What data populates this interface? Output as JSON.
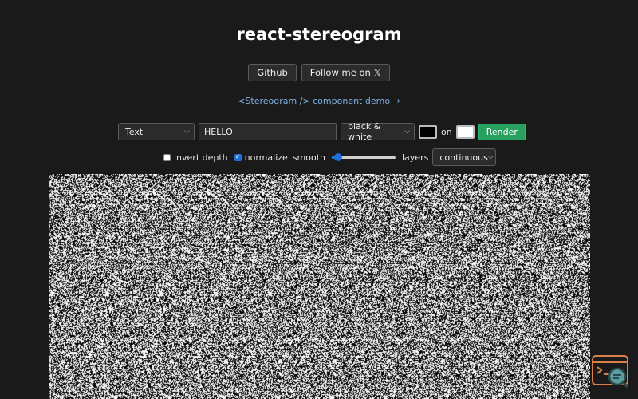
{
  "header": {
    "title": "react-stereogram"
  },
  "buttons": {
    "github_label": "Github",
    "follow_label": "Follow me on 𝕏"
  },
  "demo_link": {
    "label": "<Stereogram /> component demo →"
  },
  "controls": {
    "source_select": {
      "value": "Text"
    },
    "text_input": {
      "value": "HELLO"
    },
    "palette_select": {
      "value": "black & white"
    },
    "foreground_color": "#000000",
    "on_label": "on",
    "background_color": "#ffffff",
    "render_label": "Render"
  },
  "options": {
    "invert_depth": {
      "label": "invert depth",
      "checked": false
    },
    "normalize": {
      "label": "normalize",
      "checked": true
    },
    "smooth": {
      "label": "smooth",
      "value_fraction": 0.1
    },
    "layers": {
      "label": "layers",
      "value": "continuous"
    }
  },
  "stereogram": {
    "pattern": "random-dot",
    "colors": [
      "#000000",
      "#ffffff"
    ]
  },
  "icons": {
    "dropdown": "chevron-down-icon",
    "corner": "terminal-search-icon"
  },
  "theme": {
    "background": "#1a1a1a",
    "accent": "#28a060",
    "link": "#7fb0e6",
    "checkbox": "#1e6fd9"
  }
}
